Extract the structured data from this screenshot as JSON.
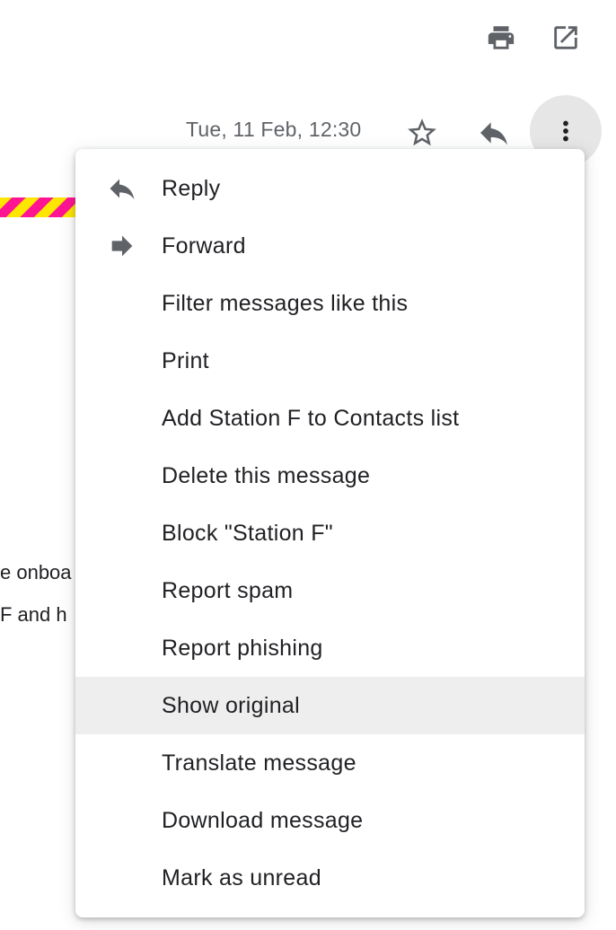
{
  "toolbar": {
    "print_icon": "print-icon",
    "open_new_window_icon": "open-in-new-icon"
  },
  "message_header": {
    "date": "Tue, 11 Feb, 12:30",
    "star_icon": "star-outline-icon",
    "reply_icon": "reply-icon",
    "more_icon": "more-vert-icon"
  },
  "email_body": {
    "line1_fragment": "e onboa",
    "line2_fragment": "F and h"
  },
  "menu": {
    "items": [
      {
        "label": "Reply",
        "icon": "reply-icon"
      },
      {
        "label": "Forward",
        "icon": "forward-icon"
      },
      {
        "label": "Filter messages like this"
      },
      {
        "label": "Print"
      },
      {
        "label": "Add Station F to Contacts list"
      },
      {
        "label": "Delete this message"
      },
      {
        "label": "Block \"Station F\""
      },
      {
        "label": "Report spam"
      },
      {
        "label": "Report phishing"
      },
      {
        "label": "Show original"
      },
      {
        "label": "Translate message"
      },
      {
        "label": "Download message"
      },
      {
        "label": "Mark as unread"
      }
    ],
    "highlighted_index": 9
  },
  "colors": {
    "icon_gray": "#5f6368",
    "text": "#202124",
    "hover_bg": "#eeeeee",
    "more_button_bg": "#e6e6e6",
    "stripe_pink": "#ff1493",
    "stripe_yellow": "#ffe600"
  }
}
